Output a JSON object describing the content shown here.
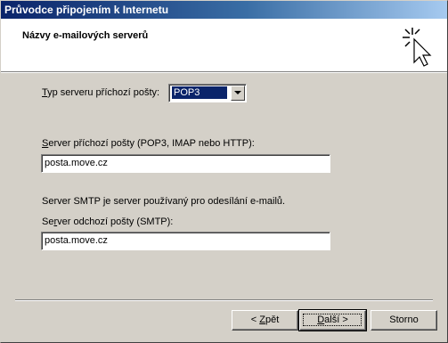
{
  "window": {
    "title": "Průvodce připojením k Internetu"
  },
  "header": {
    "title": "Názvy e-mailových serverů",
    "icon": "wizard-sparkle-cursor-icon"
  },
  "incoming_type": {
    "label_prefix": "",
    "label_mnemonic": "T",
    "label_rest": "yp serveru příchozí pošty:",
    "selected": "POP3"
  },
  "incoming_server": {
    "label_prefix": "",
    "label_mnemonic": "S",
    "label_rest": "erver příchozí pošty (POP3, IMAP nebo HTTP):",
    "value": "posta.move.cz"
  },
  "smtp_note": "Server SMTP je server používaný pro odesílání e-mailů.",
  "outgoing_server": {
    "label_prefix": "Se",
    "label_mnemonic": "r",
    "label_rest": "ver odchozí pošty (SMTP):",
    "value": "posta.move.cz"
  },
  "buttons": {
    "back_prefix": "< ",
    "back_mnemonic": "Z",
    "back_rest": "pět",
    "next_prefix": "",
    "next_mnemonic": "D",
    "next_rest": "alší >",
    "cancel": "Storno"
  }
}
